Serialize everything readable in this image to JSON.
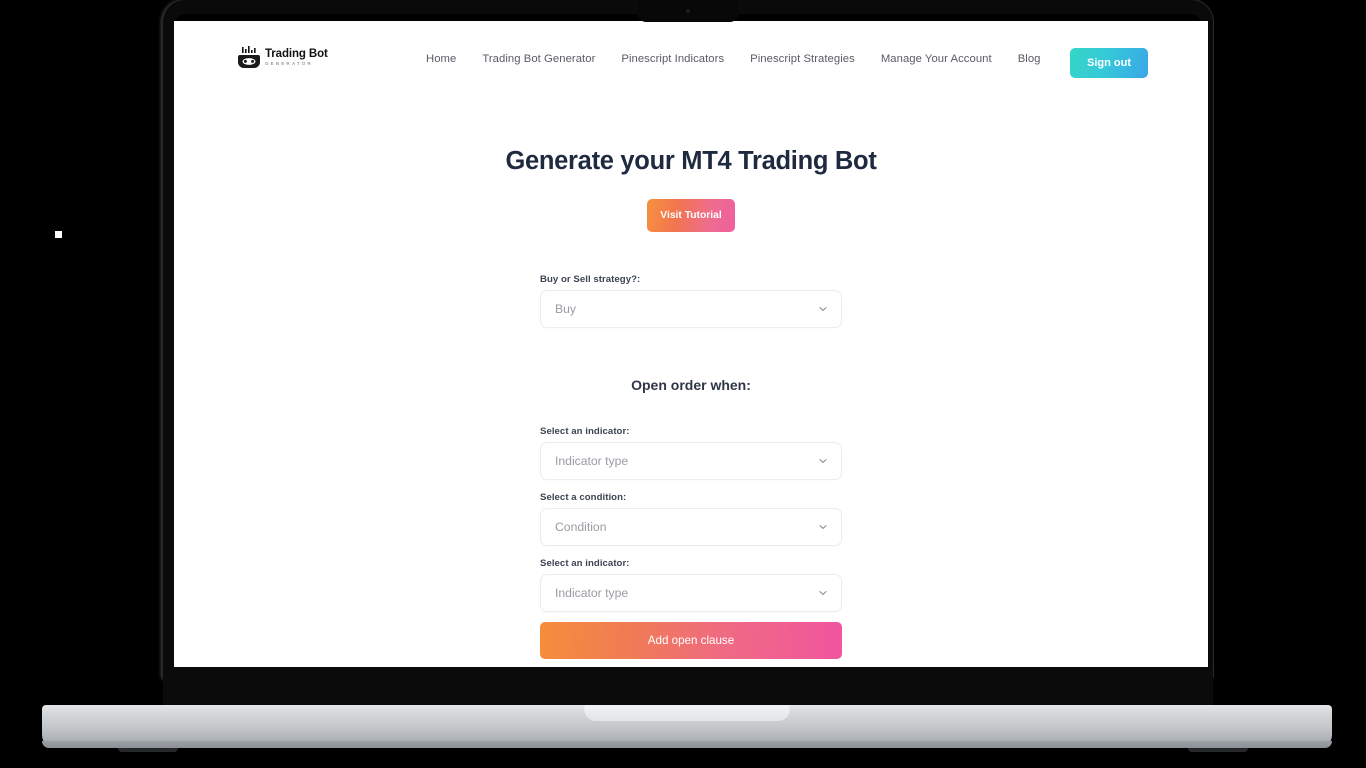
{
  "brand": {
    "name": "Trading Bot",
    "tagline": "GENERATOR",
    "logo_icon": "trading-bot-logo-icon"
  },
  "nav": {
    "items": [
      {
        "label": "Home"
      },
      {
        "label": "Trading Bot Generator"
      },
      {
        "label": "Pinescript Indicators"
      },
      {
        "label": "Pinescript Strategies"
      },
      {
        "label": "Manage Your Account"
      },
      {
        "label": "Blog"
      }
    ],
    "signout_label": "Sign out"
  },
  "hero": {
    "title": "Generate your MT4 Trading Bot",
    "tutorial_button": "Visit Tutorial"
  },
  "form": {
    "strategy": {
      "label": "Buy or Sell strategy?:",
      "value": "Buy"
    },
    "section_heading": "Open order when:",
    "indicator_one": {
      "label": "Select an indicator:",
      "value": "Indicator type"
    },
    "condition": {
      "label": "Select a condition:",
      "value": "Condition"
    },
    "indicator_two": {
      "label": "Select an indicator:",
      "value": "Indicator type"
    },
    "submit_label": "Add open clause"
  },
  "colors": {
    "accent_gradient_start": "#f58e3c",
    "accent_gradient_end": "#f1559f",
    "signout_gradient_start": "#35d6c6",
    "signout_gradient_end": "#3aa6e8",
    "heading": "#1f2a40",
    "nav_text": "#5b5b66",
    "placeholder": "#9b9ba3",
    "field_border": "#ececec",
    "page_background": "#ffffff",
    "canvas_background": "#000000"
  }
}
